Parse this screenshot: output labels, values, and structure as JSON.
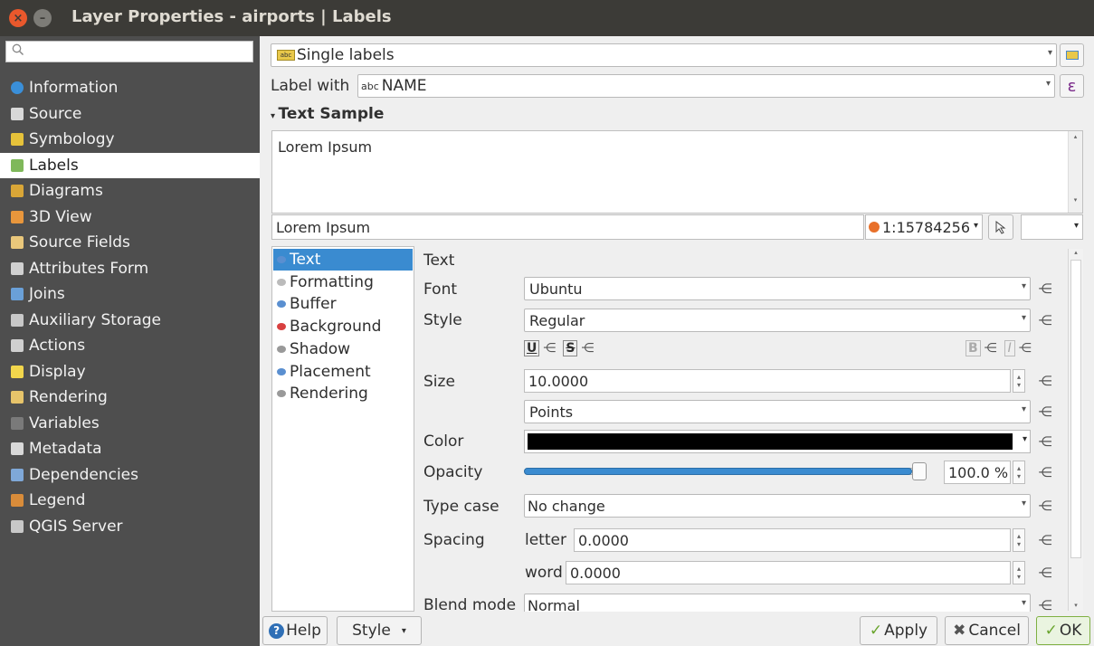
{
  "window": {
    "title": "Layer Properties - airports | Labels",
    "close_glyph": "×",
    "min_glyph": "–"
  },
  "sidebar": {
    "search_placeholder": "",
    "items": [
      {
        "label": "Information",
        "icon": "info-icon",
        "color": "#3a8fd9"
      },
      {
        "label": "Source",
        "icon": "source-icon",
        "color": "#d8d8d8"
      },
      {
        "label": "Symbology",
        "icon": "symbology-icon",
        "color": "#e6c23a"
      },
      {
        "label": "Labels",
        "icon": "labels-icon",
        "color": "#7fb85a"
      },
      {
        "label": "Diagrams",
        "icon": "diagrams-icon",
        "color": "#d9a637"
      },
      {
        "label": "3D View",
        "icon": "3d-view-icon",
        "color": "#e8963c"
      },
      {
        "label": "Source Fields",
        "icon": "source-fields-icon",
        "color": "#e9c77b"
      },
      {
        "label": "Attributes Form",
        "icon": "attributes-form-icon",
        "color": "#d0d0d0"
      },
      {
        "label": "Joins",
        "icon": "joins-icon",
        "color": "#6aa0d8"
      },
      {
        "label": "Auxiliary Storage",
        "icon": "auxiliary-storage-icon",
        "color": "#c8c8c8"
      },
      {
        "label": "Actions",
        "icon": "actions-icon",
        "color": "#d0d0d0"
      },
      {
        "label": "Display",
        "icon": "display-icon",
        "color": "#f2d64c"
      },
      {
        "label": "Rendering",
        "icon": "rendering-icon",
        "color": "#e7c46a"
      },
      {
        "label": "Variables",
        "icon": "variables-icon",
        "color": "#7a7a7a"
      },
      {
        "label": "Metadata",
        "icon": "metadata-icon",
        "color": "#d8d8d8"
      },
      {
        "label": "Dependencies",
        "icon": "dependencies-icon",
        "color": "#7fa8d8"
      },
      {
        "label": "Legend",
        "icon": "legend-icon",
        "color": "#d98c3a"
      },
      {
        "label": "QGIS Server",
        "icon": "qgis-server-icon",
        "color": "#c8c8c8"
      }
    ]
  },
  "mode": {
    "value": "Single labels",
    "icon_text": "abc"
  },
  "label_with": {
    "label": "Label with",
    "type_badge": "abc",
    "value": "NAME",
    "expr_glyph": "ε"
  },
  "text_sample": {
    "header": "Text Sample",
    "preview_text": "Lorem Ipsum",
    "sample_input": "Lorem Ipsum",
    "scale": "1:15784256"
  },
  "tabs": {
    "items": [
      {
        "label": "Text",
        "icon": "text-tab-icon",
        "color": "#5a8fd0"
      },
      {
        "label": "Formatting",
        "icon": "formatting-icon",
        "color": "#bbbbbb"
      },
      {
        "label": "Buffer",
        "icon": "buffer-icon",
        "color": "#5a8fd0"
      },
      {
        "label": "Background",
        "icon": "background-icon",
        "color": "#d84040"
      },
      {
        "label": "Shadow",
        "icon": "shadow-icon",
        "color": "#999999"
      },
      {
        "label": "Placement",
        "icon": "placement-icon",
        "color": "#5a8fd0"
      },
      {
        "label": "Rendering",
        "icon": "rendering-tab-icon",
        "color": "#999999"
      }
    ]
  },
  "text_panel": {
    "heading": "Text",
    "font_label": "Font",
    "font_value": "Ubuntu",
    "style_label": "Style",
    "style_value": "Regular",
    "fmt_u": "U",
    "fmt_s": "S",
    "fmt_b": "B",
    "fmt_i": "I",
    "size_label": "Size",
    "size_value": "10.0000",
    "size_unit": "Points",
    "color_label": "Color",
    "color_value": "#000000",
    "opacity_label": "Opacity",
    "opacity_value": "100.0 %",
    "opacity_fraction": 1.0,
    "typecase_label": "Type case",
    "typecase_value": "No change",
    "spacing_label": "Spacing",
    "letter_label": "letter",
    "letter_value": "0.0000",
    "word_label": "word",
    "word_value": "0.0000",
    "blend_label": "Blend mode",
    "blend_value": "Normal"
  },
  "footer": {
    "help": "Help",
    "style": "Style",
    "apply": "Apply",
    "cancel": "Cancel",
    "ok": "OK"
  }
}
